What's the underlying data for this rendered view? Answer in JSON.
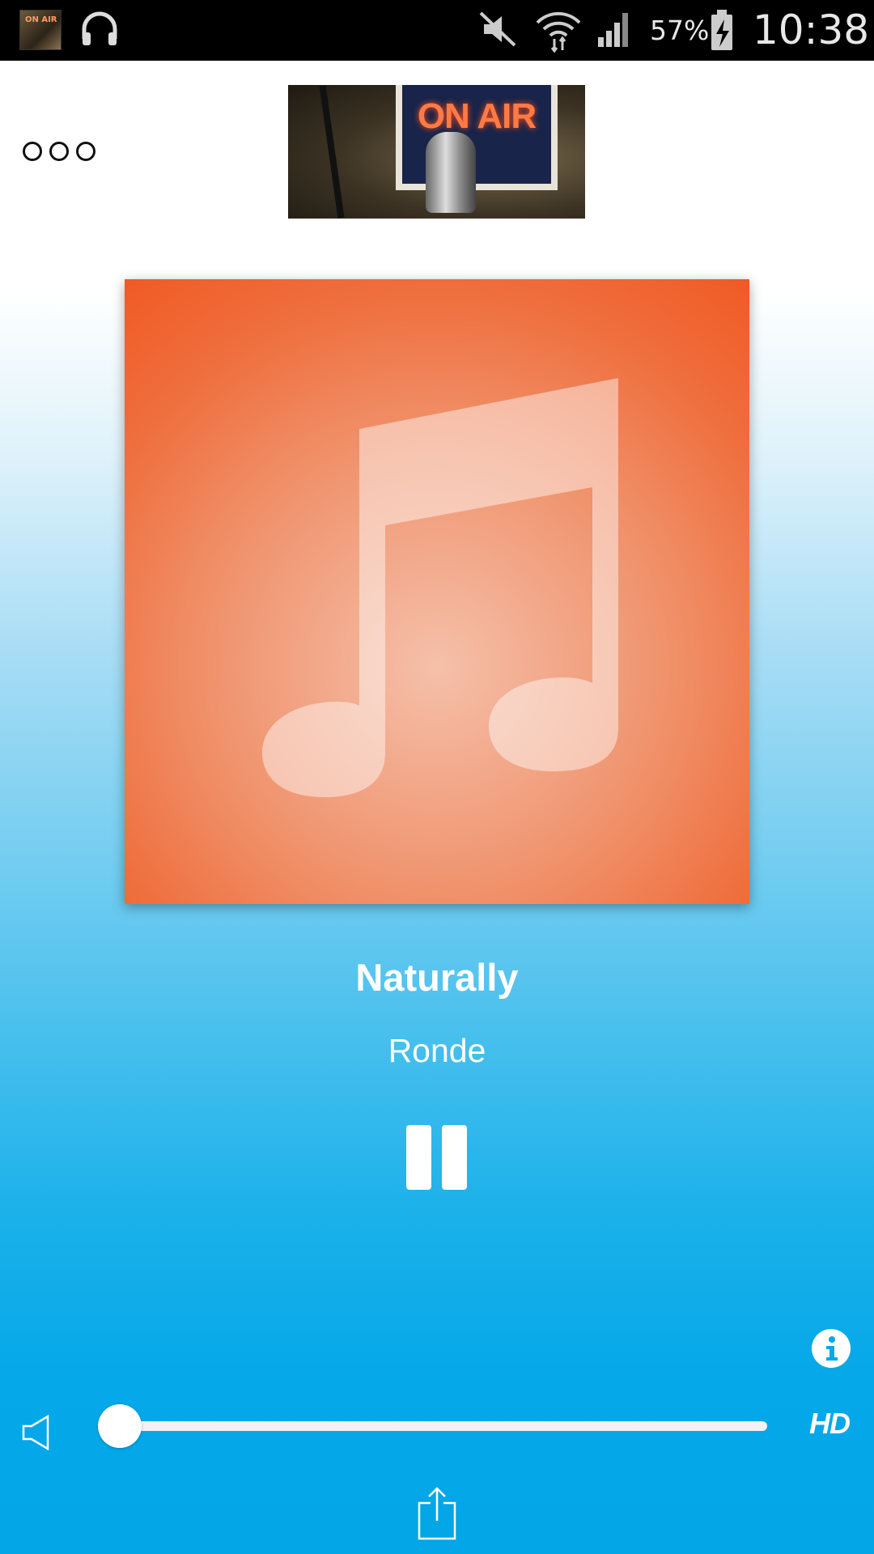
{
  "status_bar": {
    "app_icon_text": "ON AIR",
    "battery": "57%",
    "time": "10:38",
    "icons": [
      "app-icon",
      "headphones-icon",
      "mute-icon",
      "wifi-icon",
      "signal-icon",
      "battery-charging-icon"
    ]
  },
  "header": {
    "menu_icon": "more-dots-icon",
    "logo_text": "ON AIR"
  },
  "now_playing": {
    "artwork_icon": "music-note-icon",
    "title": "Naturally",
    "artist": "Ronde",
    "state": "playing"
  },
  "controls": {
    "pause_icon": "pause-icon",
    "info_icon": "info-icon",
    "volume_icon": "speaker-icon",
    "volume_level": 0,
    "quality_label": "HD",
    "share_icon": "share-icon"
  },
  "colors": {
    "art_orange": "#f05a24",
    "background_blue": "#03a6e7",
    "status_bar": "#000000"
  }
}
